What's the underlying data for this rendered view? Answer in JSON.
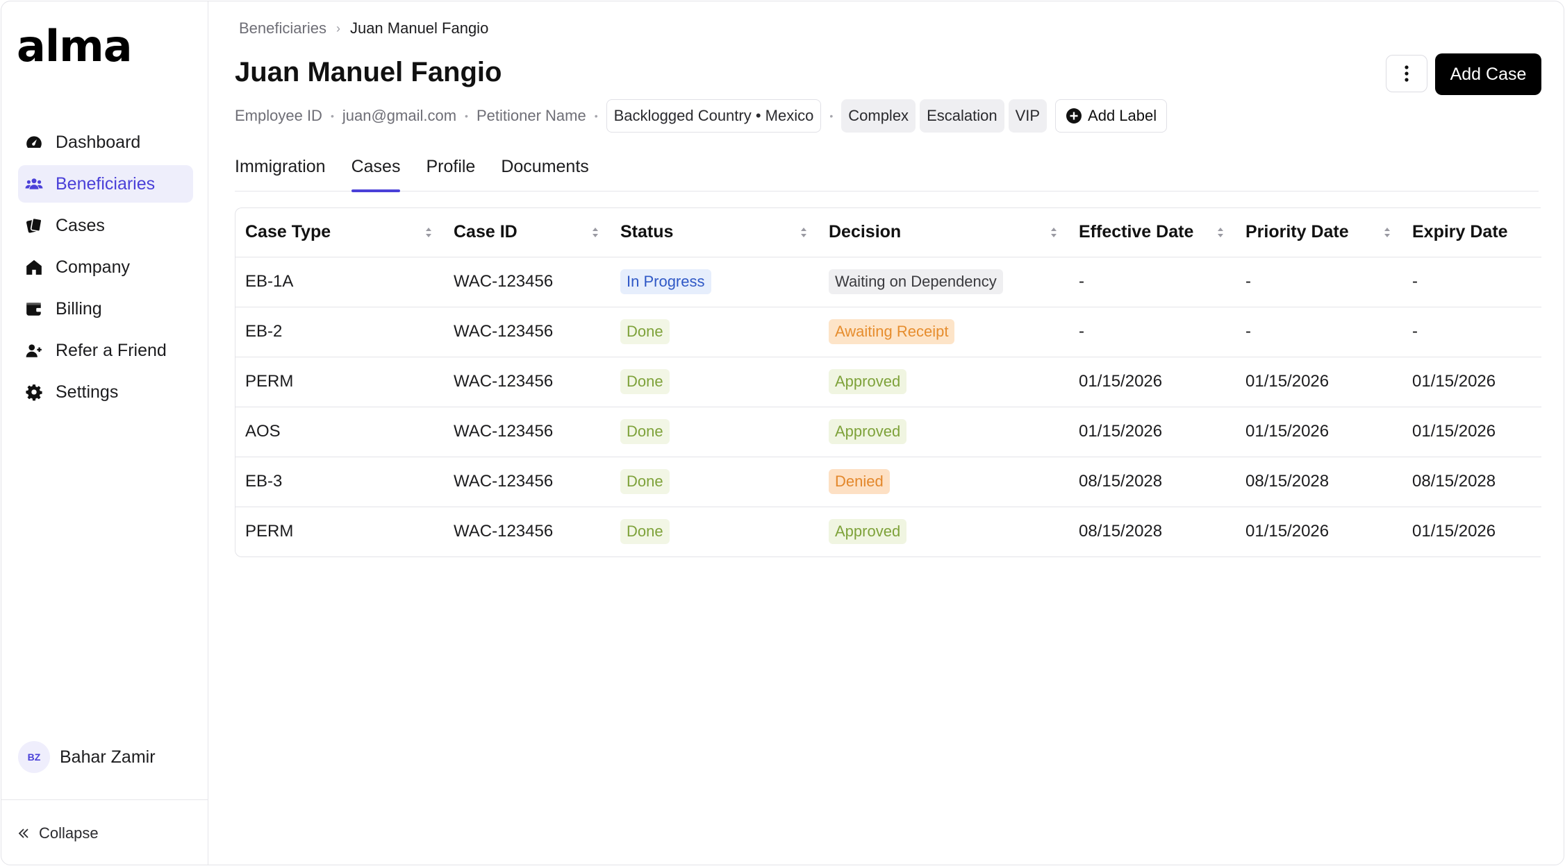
{
  "app": {
    "logo_text": "alma"
  },
  "sidebar": {
    "items": [
      {
        "label": "Dashboard",
        "icon": "dashboard-icon",
        "active": false
      },
      {
        "label": "Beneficiaries",
        "icon": "users-icon",
        "active": true
      },
      {
        "label": "Cases",
        "icon": "cases-icon",
        "active": false
      },
      {
        "label": "Company",
        "icon": "home-icon",
        "active": false
      },
      {
        "label": "Billing",
        "icon": "wallet-icon",
        "active": false
      },
      {
        "label": "Refer a Friend",
        "icon": "user-plus-icon",
        "active": false
      },
      {
        "label": "Settings",
        "icon": "gear-icon",
        "active": false
      }
    ],
    "user": {
      "initials": "BZ",
      "name": "Bahar Zamir"
    },
    "collapse_label": "Collapse"
  },
  "breadcrumb": {
    "parent": "Beneficiaries",
    "current": "Juan Manuel Fangio"
  },
  "header": {
    "title": "Juan Manuel Fangio",
    "add_case_label": "Add Case"
  },
  "meta": {
    "employee_id": "Employee ID",
    "email": "juan@gmail.com",
    "petitioner": "Petitioner Name",
    "backlogged": "Backlogged Country • Mexico",
    "labels": [
      "Complex",
      "Escalation",
      "VIP"
    ],
    "add_label": "Add Label"
  },
  "tabs": [
    {
      "label": "Immigration",
      "active": false
    },
    {
      "label": "Cases",
      "active": true
    },
    {
      "label": "Profile",
      "active": false
    },
    {
      "label": "Documents",
      "active": false
    }
  ],
  "table": {
    "columns": [
      "Case Type",
      "Case ID",
      "Status",
      "Decision",
      "Effective Date",
      "Priority Date",
      "Expiry Date"
    ],
    "rows": [
      {
        "case_type": "EB-1A",
        "case_id": "WAC-123456",
        "status": "In Progress",
        "decision": "Waiting on Dependency",
        "effective": "-",
        "priority": "-",
        "expiry": "-"
      },
      {
        "case_type": "EB-2",
        "case_id": "WAC-123456",
        "status": "Done",
        "decision": "Awaiting Receipt",
        "effective": "-",
        "priority": "-",
        "expiry": "-"
      },
      {
        "case_type": "PERM",
        "case_id": "WAC-123456",
        "status": "Done",
        "decision": "Approved",
        "effective": "01/15/2026",
        "priority": "01/15/2026",
        "expiry": "01/15/2026"
      },
      {
        "case_type": "AOS",
        "case_id": "WAC-123456",
        "status": "Done",
        "decision": "Approved",
        "effective": "01/15/2026",
        "priority": "01/15/2026",
        "expiry": "01/15/2026"
      },
      {
        "case_type": "EB-3",
        "case_id": "WAC-123456",
        "status": "Done",
        "decision": "Denied",
        "effective": "08/15/2028",
        "priority": "08/15/2028",
        "expiry": "08/15/2028"
      },
      {
        "case_type": "PERM",
        "case_id": "WAC-123456",
        "status": "Done",
        "decision": "Approved",
        "effective": "08/15/2028",
        "priority": "01/15/2026",
        "expiry": "01/15/2026"
      }
    ]
  },
  "colors": {
    "accent": "#4a40d8",
    "primary_button": "#000000"
  }
}
